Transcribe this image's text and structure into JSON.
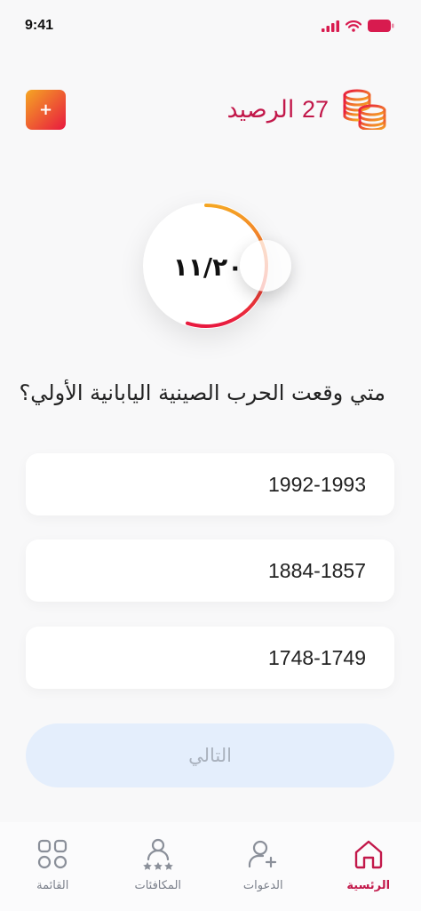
{
  "status_bar": {
    "time": "9:41"
  },
  "header": {
    "add_label": "+",
    "balance_number": "27",
    "balance_label": "الرصيد"
  },
  "timer": {
    "text": "١١/٢٠",
    "progress": 0.55,
    "colors": [
      "#f5a623",
      "#e8193f"
    ]
  },
  "question": {
    "text": "متي وقعت الحرب الصينية اليابانية الأولي؟"
  },
  "options": [
    "1992-1993",
    "1884-1857",
    "1748-1749"
  ],
  "next_button": {
    "label": "التالي"
  },
  "nav": {
    "items": [
      {
        "label": "القائمة",
        "icon": "grid-icon"
      },
      {
        "label": "المكافئات",
        "icon": "rewards-icon"
      },
      {
        "label": "الدعوات",
        "icon": "add-user-icon"
      },
      {
        "label": "الرئسية",
        "icon": "home-icon",
        "active": true
      }
    ]
  },
  "colors": {
    "accent": "#c2184a",
    "gradient_start": "#f5a623",
    "gradient_end": "#e8193f",
    "next_bg": "#e4eefc"
  }
}
